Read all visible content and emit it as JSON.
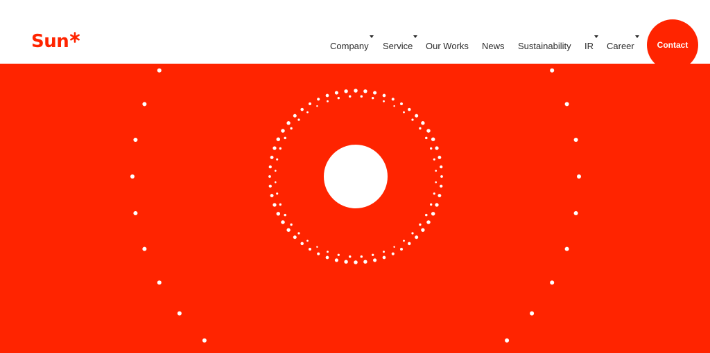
{
  "brand": {
    "name": "Sun",
    "logo_star_icon": "asterisk-star-icon"
  },
  "nav": {
    "items": [
      {
        "label": "Company",
        "dropdown": true
      },
      {
        "label": "Service",
        "dropdown": true
      },
      {
        "label": "Our Works",
        "dropdown": false
      },
      {
        "label": "News",
        "dropdown": false
      },
      {
        "label": "Sustainability",
        "dropdown": false
      },
      {
        "label": "IR",
        "dropdown": true
      },
      {
        "label": "Career",
        "dropdown": true
      }
    ],
    "contact_label": "Contact",
    "dropdown_icon": "caret-down-icon"
  },
  "colors": {
    "brand_red": "#ff2400",
    "white": "#ffffff",
    "nav_text": "#2a2a2a"
  },
  "hero": {
    "graphic_icon": "sun-dotted-rings-graphic"
  }
}
